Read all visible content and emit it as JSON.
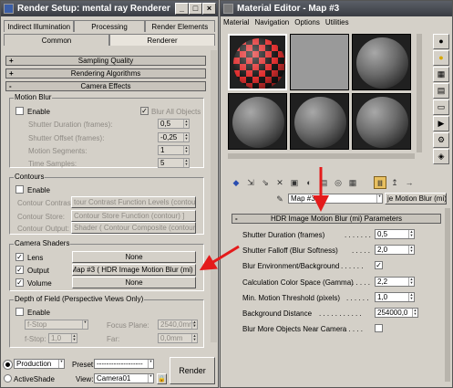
{
  "render_setup": {
    "title": "Render Setup: mental ray Renderer",
    "tabs_row1": [
      "Indirect Illumination",
      "Processing",
      "Render Elements"
    ],
    "tabs_row2": [
      "Common",
      "Renderer"
    ],
    "rollouts": {
      "sampling": "Sampling Quality",
      "algorithms": "Rendering Algorithms",
      "camera_effects": "Camera Effects"
    },
    "motion_blur": {
      "group": "Motion Blur",
      "enable": "Enable",
      "blur_all": "Blur All Objects",
      "shutter_duration_label": "Shutter Duration (frames):",
      "shutter_duration": "0,5",
      "shutter_offset_label": "Shutter Offset (frames):",
      "shutter_offset": "-0,25",
      "segments_label": "Motion Segments:",
      "segments": "1",
      "time_samples_label": "Time Samples:",
      "time_samples": "5"
    },
    "contours": {
      "group": "Contours",
      "enable": "Enable",
      "contrast_label": "Contour Contrast:",
      "contrast": "tour Contrast Function Levels (contour) ]",
      "store_label": "Contour Store:",
      "store": "Contour Store Function (contour) ]",
      "output_label": "Contour Output:",
      "output": "Shader ( Contour Composite (contour) ]"
    },
    "camera_shaders": {
      "group": "Camera Shaders",
      "lens": "Lens",
      "lens_value": "None",
      "output": "Output",
      "output_value": "Map #3 ( HDR Image Motion Blur (mi) )",
      "volume": "Volume",
      "volume_value": "None"
    },
    "dof": {
      "group": "Depth of Field (Perspective Views Only)",
      "enable": "Enable",
      "mode": "f-Stop",
      "fstop_label": "f-Stop:",
      "fstop": "1,0",
      "focus_label": "Focus Plane:",
      "focus": "2540,0mm",
      "far_label": "Far:",
      "far": "0,0mm"
    },
    "bottom": {
      "production": "Production",
      "activeshade": "ActiveShade",
      "preset_label": "Preset:",
      "preset": "-------------------",
      "view_label": "View:",
      "view": "Camera01",
      "render": "Render"
    }
  },
  "material_editor": {
    "title": "Material Editor - Map #3",
    "menu": [
      "Material",
      "Navigation",
      "Options",
      "Utilities"
    ],
    "map_name": "Map #3",
    "map_type": "je Motion Blur (mi)",
    "rollout": "HDR Image Motion Blur (mi) Parameters",
    "params": [
      {
        "label": "Shutter Duration (frames)",
        "value": "0,5"
      },
      {
        "label": "Shutter Falloff (Blur Softness)",
        "value": "2,0"
      },
      {
        "label": "Blur Environment/Background",
        "value": "✓"
      },
      {
        "label": "Calculation Color Space (Gamma)",
        "value": "2,2"
      },
      {
        "label": "Min. Motion Threshold (pixels)",
        "value": "1,0"
      },
      {
        "label": "Background Distance",
        "value": "254000,0"
      },
      {
        "label": "Blur More Objects Near Camera",
        "value": ""
      }
    ]
  },
  "colors": {
    "arrow": "#e41b1b",
    "titlebar": "#44474e",
    "checker_red": "#e03030"
  }
}
